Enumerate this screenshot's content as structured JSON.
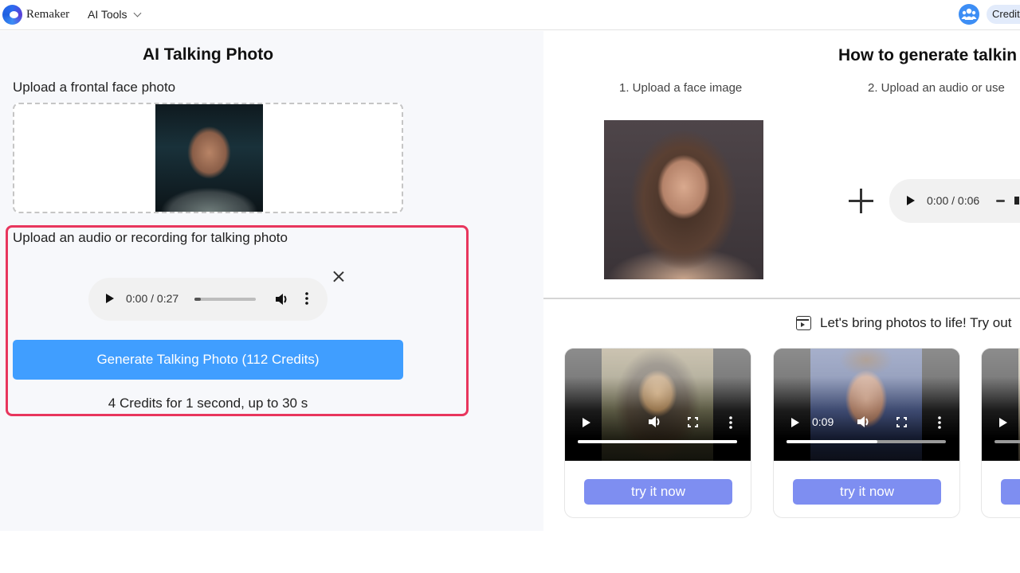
{
  "header": {
    "brand": "Remaker",
    "ai_tools_label": "AI Tools",
    "credit_label": "Credit",
    "icons": {
      "logo": "remaker-logo-icon",
      "community": "group-icon",
      "dropdown": "chevron-down-icon"
    }
  },
  "left_panel": {
    "title": "AI Talking Photo",
    "photo_upload_label": "Upload a frontal face photo",
    "audio_upload_label": "Upload an audio or recording for talking photo",
    "audio_player": {
      "time": "0:00 / 0:27",
      "progress_percent": 10
    },
    "generate_button": "Generate Talking Photo (112 Credits)",
    "credits_note": "4 Credits for 1 second, up to 30 s",
    "highlight_color": "#e8365d",
    "button_color": "#409eff"
  },
  "right_panel": {
    "title": "How to generate talkin",
    "step1_label": "1. Upload a face image",
    "step2_label": "2. Upload an audio or use",
    "example_audio": {
      "time": "0:00 / 0:06"
    },
    "try_section_label": "Let's bring photos to life! Try out",
    "try_button_color": "#7e8ef1",
    "examples": [
      {
        "subject": "mona-lisa",
        "time": "",
        "progress_percent": 100,
        "button": "try it now"
      },
      {
        "subject": "man-portrait",
        "time": "0:09",
        "progress_percent": 57,
        "button": "try it now"
      },
      {
        "subject": "third-example",
        "time": "",
        "progress_percent": 0,
        "button": ""
      }
    ]
  }
}
